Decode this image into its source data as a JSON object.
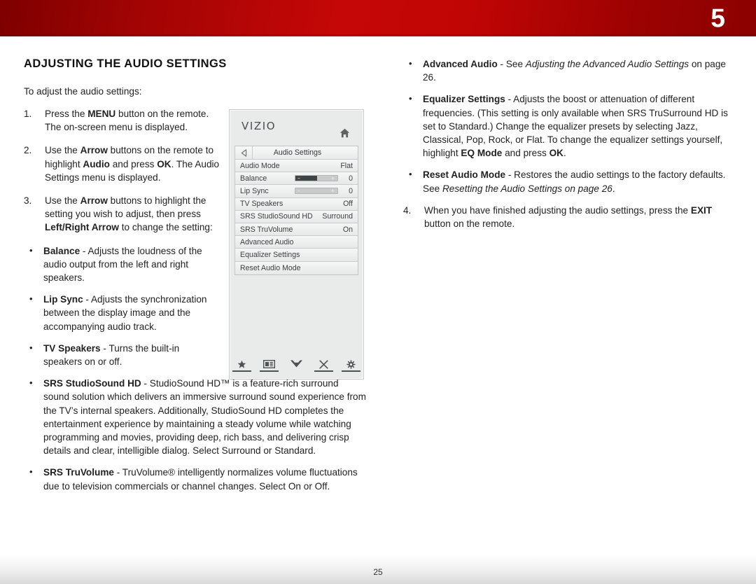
{
  "banner": {
    "chapter_number": "5",
    "color_start": "#7e0000",
    "color_mid": "#c50707",
    "color_end": "#8c0101"
  },
  "page": {
    "number": "25"
  },
  "left_column": {
    "title": "ADJUSTING THE AUDIO SETTINGS",
    "lead": "To adjust the audio settings:",
    "steps": [
      {
        "num": "1.",
        "parts": [
          {
            "t": "Press the ",
            "s": "n"
          },
          {
            "t": "MENU",
            "s": "b"
          },
          {
            "t": " button on the remote. The on-screen menu is displayed.",
            "s": "n"
          }
        ]
      },
      {
        "num": "2.",
        "parts": [
          {
            "t": "Use the ",
            "s": "n"
          },
          {
            "t": "Arrow",
            "s": "b"
          },
          {
            "t": " buttons on the remote to highlight ",
            "s": "n"
          },
          {
            "t": "Audio",
            "s": "b"
          },
          {
            "t": " and press ",
            "s": "n"
          },
          {
            "t": "OK",
            "s": "b"
          },
          {
            "t": ". The Audio Settings menu is displayed.",
            "s": "n"
          }
        ]
      },
      {
        "num": "3.",
        "parts": [
          {
            "t": "Use the ",
            "s": "n"
          },
          {
            "t": "Arrow",
            "s": "b"
          },
          {
            "t": " buttons to highlight the setting you wish to adjust, then press ",
            "s": "n"
          },
          {
            "t": "Left/Right Arrow",
            "s": "b"
          },
          {
            "t": " to change the setting:",
            "s": "n"
          }
        ]
      }
    ],
    "bullets_narrow": [
      {
        "parts": [
          {
            "t": "Balance",
            "s": "b"
          },
          {
            "t": " - Adjusts the loudness of the audio output from the left and right speakers.",
            "s": "n"
          }
        ]
      },
      {
        "parts": [
          {
            "t": "Lip Sync",
            "s": "b"
          },
          {
            "t": " - Adjusts the synchronization between the display image and the accompanying audio track.",
            "s": "n"
          }
        ]
      },
      {
        "parts": [
          {
            "t": "TV Speakers",
            "s": "b"
          },
          {
            "t": " - Turns the built-in speakers on or off.",
            "s": "n"
          }
        ]
      }
    ],
    "bullets_wide": [
      {
        "parts": [
          {
            "t": "SRS StudioSound HD",
            "s": "b"
          },
          {
            "t": " - StudioSound HD™ is a feature-rich surround sound solution which delivers an immersive surround sound experience from the TV’s internal speakers. Additionally, StudioSound HD completes the entertainment experience by maintaining a steady volume while watching programming and movies, providing deep, rich bass, and delivering crisp details and clear, intelligible dialog. Select Surround or Standard.",
            "s": "n"
          }
        ]
      },
      {
        "parts": [
          {
            "t": "SRS TruVolume",
            "s": "b"
          },
          {
            "t": " - TruVolume® intelligently normalizes volume fluctuations due to television commercials or channel changes. Select On or Off.",
            "s": "n"
          }
        ]
      }
    ]
  },
  "right_column": {
    "bullets": [
      {
        "parts": [
          {
            "t": "Advanced Audio",
            "s": "b"
          },
          {
            "t": " - See ",
            "s": "n"
          },
          {
            "t": "Adjusting the Advanced Audio Settings",
            "s": "i"
          },
          {
            "t": " on page 26.",
            "s": "n"
          }
        ]
      },
      {
        "parts": [
          {
            "t": "Equalizer Settings",
            "s": "b"
          },
          {
            "t": " - Adjusts the boost or attenuation of different frequencies. (This setting is only available when SRS TruSurround HD is set to Standard.) Change the equalizer presets by selecting Jazz, Classical, Pop, Rock, or Flat. To change the equalizer settings yourself, highlight ",
            "s": "n"
          },
          {
            "t": "EQ Mode",
            "s": "b"
          },
          {
            "t": " and press ",
            "s": "n"
          },
          {
            "t": "OK",
            "s": "b"
          },
          {
            "t": ".",
            "s": "n"
          }
        ]
      },
      {
        "parts": [
          {
            "t": "Reset Audio Mode",
            "s": "b"
          },
          {
            "t": " - Restores the audio settings to the factory defaults. See ",
            "s": "n"
          },
          {
            "t": "Resetting the Audio Settings on page 26",
            "s": "i"
          },
          {
            "t": ".",
            "s": "n"
          }
        ]
      }
    ],
    "steps": [
      {
        "num": "4.",
        "parts": [
          {
            "t": "When you have finished adjusting the audio settings, press the ",
            "s": "n"
          },
          {
            "t": "EXIT",
            "s": "b"
          },
          {
            "t": " button on the remote.",
            "s": "n"
          }
        ]
      }
    ]
  },
  "tv_menu": {
    "brand": "VIZIO",
    "home_icon": "home-icon",
    "back_icon": "back-arrow-icon",
    "title": "Audio Settings",
    "rows": [
      {
        "label": "Audio Mode",
        "value": "Flat",
        "type": "value"
      },
      {
        "label": "Balance",
        "value": "0",
        "type": "slider",
        "fill_pct": 52,
        "dark": true
      },
      {
        "label": "Lip Sync",
        "value": "0",
        "type": "slider",
        "fill_pct": 0,
        "dark": false
      },
      {
        "label": "TV Speakers",
        "value": "Off",
        "type": "value"
      },
      {
        "label": "SRS StudioSound HD",
        "value": "Surround",
        "type": "value"
      },
      {
        "label": "SRS TruVolume",
        "value": "On",
        "type": "value"
      },
      {
        "label": "Advanced Audio",
        "value": "",
        "type": "plain"
      },
      {
        "label": "Equalizer Settings",
        "value": "",
        "type": "plain"
      },
      {
        "label": "Reset Audio Mode",
        "value": "",
        "type": "plain"
      }
    ],
    "footer_icons": [
      {
        "name": "star-icon",
        "bar": true
      },
      {
        "name": "picture-icon",
        "bar": true
      },
      {
        "name": "chevron-down-icon",
        "bar": false
      },
      {
        "name": "close-x-icon",
        "bar": true
      },
      {
        "name": "gear-icon",
        "bar": true
      }
    ]
  }
}
